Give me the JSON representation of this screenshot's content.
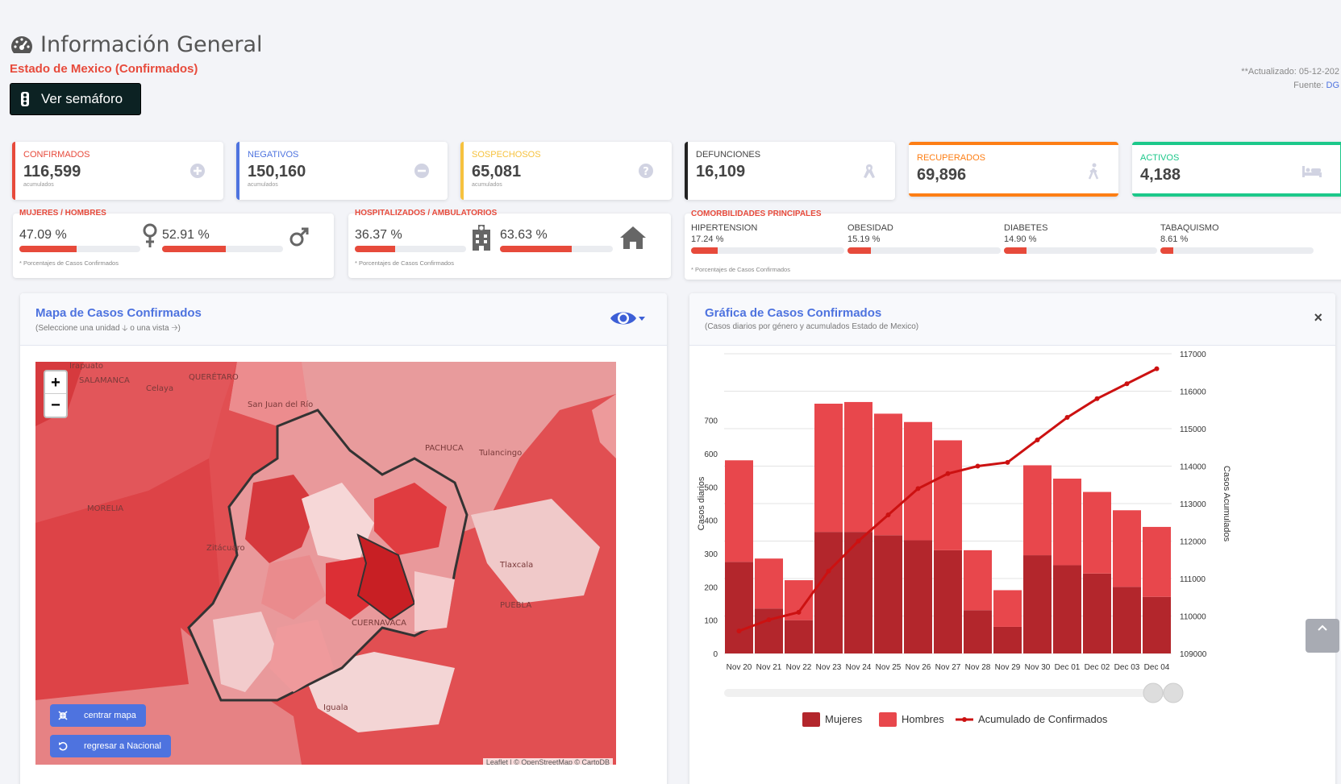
{
  "header": {
    "title": "Información General",
    "subtitle": "Estado de Mexico (Confirmados)",
    "semaforo_button": "Ver semáforo",
    "updated": "**Actualizado: 05-12-202",
    "source_label": "Fuente:",
    "source_link": "DG"
  },
  "cards": [
    {
      "label": "CONFIRMADOS",
      "value": "116,599",
      "sub": "acumulados",
      "color": "#e74a3b",
      "icon": "plus-circle-icon"
    },
    {
      "label": "NEGATIVOS",
      "value": "150,160",
      "sub": "acumulados",
      "color": "#4e73df",
      "icon": "minus-circle-icon"
    },
    {
      "label": "SOSPECHOSOS",
      "value": "65,081",
      "sub": "acumulados",
      "color": "#f6c23e",
      "icon": "question-circle-icon"
    },
    {
      "label": "DEFUNCIONES",
      "value": "16,109",
      "sub": "",
      "color": "#222222",
      "icon": "ribbon-icon"
    },
    {
      "label": "RECUPERADOS",
      "value": "69,896",
      "color": "#fd7e14",
      "icon": "walking-icon"
    },
    {
      "label": "ACTIVOS",
      "value": "4,188",
      "color": "#1cc88a",
      "icon": "bed-icon"
    }
  ],
  "gender": {
    "heading": "MUJERES / HOMBRES",
    "women_pct": "47.09 %",
    "women_value": 47.09,
    "men_pct": "52.91 %",
    "men_value": 52.91,
    "note": "* Porcentajes  de Casos Confirmados"
  },
  "hospital": {
    "heading": "HOSPITALIZADOS / AMBULATORIOS",
    "hosp_pct": "36.37 %",
    "hosp_value": 36.37,
    "amb_pct": "63.63 %",
    "amb_value": 63.63,
    "note": "* Porcentajes  de Casos Confirmados"
  },
  "comorbidities": {
    "heading": "COMORBILIDADES PRINCIPALES",
    "items": [
      {
        "name": "HIPERTENSION",
        "pct": "17.24 %",
        "value": 17.24
      },
      {
        "name": "OBESIDAD",
        "pct": "15.19 %",
        "value": 15.19
      },
      {
        "name": "DIABETES",
        "pct": "14.90 %",
        "value": 14.9
      },
      {
        "name": "TABAQUISMO",
        "pct": "8.61 %",
        "value": 8.61
      }
    ],
    "note": "* Porcentajes  de Casos Confirmados"
  },
  "map_panel": {
    "title": "Mapa de Casos Confirmados",
    "subtitle": "(Seleccione una unidad 🡣 o una vista 🡢)",
    "center_button": "centrar mapa",
    "national_button": "regresar a Nacional",
    "attribution": "Leaflet | © OpenStreetMap © CartoDB",
    "zoom_in": "+",
    "zoom_out": "−",
    "places": [
      "Irapuato",
      "SALAMANCA",
      "Celaya",
      "QUERÉTARO",
      "San Juan del Río",
      "PACHUCA",
      "Tulancingo",
      "MORELIA",
      "Zitácuaro",
      "Tlaxcala",
      "PUEBLA",
      "CUERNAVACA",
      "Iguala"
    ]
  },
  "chart_panel": {
    "title": "Gráfica de Casos Confirmados",
    "subtitle": "(Casos diarios por género y acumulados Estado de Mexico)",
    "close": "×"
  },
  "chart_data": {
    "type": "bar",
    "categories": [
      "Nov 20",
      "Nov 21",
      "Nov 22",
      "Nov 23",
      "Nov 24",
      "Nov 25",
      "Nov 26",
      "Nov 27",
      "Nov 28",
      "Nov 29",
      "Nov 30",
      "Dec 01",
      "Dec 02",
      "Dec 03",
      "Dec 04"
    ],
    "series": [
      {
        "name": "Mujeres",
        "type": "bar",
        "stack": "daily",
        "color": "#b3262c",
        "values": [
          275,
          135,
          100,
          365,
          365,
          355,
          340,
          310,
          130,
          80,
          295,
          265,
          240,
          200,
          170
        ]
      },
      {
        "name": "Hombres",
        "type": "bar",
        "stack": "daily",
        "color": "#e8474c",
        "values": [
          305,
          150,
          120,
          385,
          390,
          365,
          355,
          330,
          180,
          110,
          270,
          260,
          245,
          230,
          210
        ]
      },
      {
        "name": "Acumulado de Confirmados",
        "type": "line",
        "axis": "right",
        "color": "#cc1111",
        "values": [
          109600,
          109900,
          110100,
          111200,
          112000,
          112700,
          113400,
          113800,
          114000,
          114100,
          114700,
          115300,
          115800,
          116200,
          116600
        ]
      }
    ],
    "ylabel": "Casos diarios",
    "ylabel_right": "Casos Acumulados",
    "ylim": [
      0,
      900
    ],
    "yticks": [
      0,
      100,
      200,
      300,
      400,
      500,
      600,
      700
    ],
    "ylim_right": [
      109000,
      117000
    ],
    "yticks_right": [
      109000,
      110000,
      111000,
      112000,
      113000,
      114000,
      115000,
      116000,
      117000
    ],
    "legend": "bottom",
    "grid": true
  },
  "colors": {
    "accent": "#e74a3b",
    "primary": "#4e73df"
  }
}
